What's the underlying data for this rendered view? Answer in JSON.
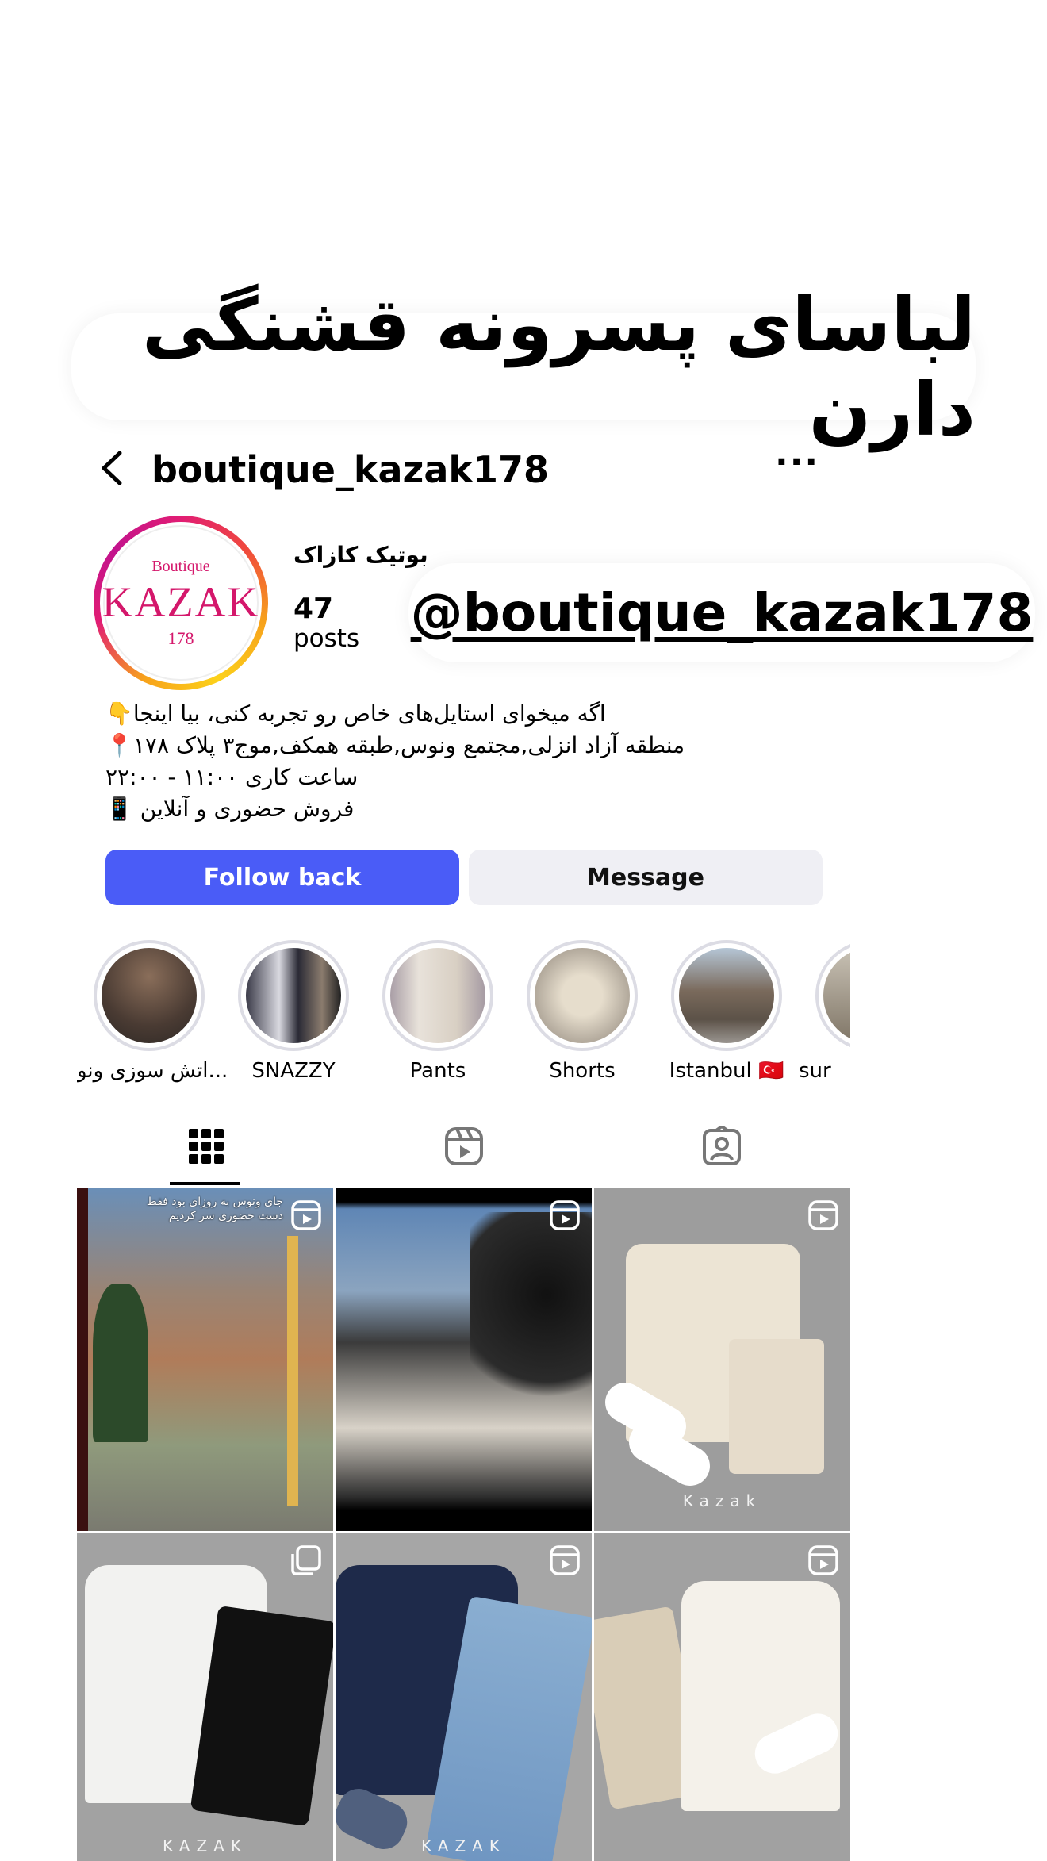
{
  "overlay": {
    "title": "لباسای پسرونه قشنگی دارن",
    "handle": "@boutique_kazak178"
  },
  "header": {
    "username": "boutique_kazak178",
    "back_icon": "chevron-left-icon",
    "more_label": "···"
  },
  "profile": {
    "display_name": "بوتیک کازاک",
    "posts_count": "47",
    "posts_label": "posts",
    "logo": {
      "top": "Boutique",
      "mid": "KAZAK",
      "bottom": "178"
    },
    "bio": [
      "اگه میخوای استایل‌های خاص رو تجربه کنی، بیا اینجا👇",
      "منطقه آزاد انزلی,مجتمع ونوس,طبقه همکف,موج۳ پلاک ۱۷۸📍",
      "ساعت کاری ۱۱:۰۰ - ۲۲:۰۰",
      "فروش حضوری و آنلاین 📱"
    ]
  },
  "buttons": {
    "follow": "Follow back",
    "message": "Message"
  },
  "highlights": [
    {
      "label": "اتش سوزی ونو..."
    },
    {
      "label": "SNAZZY"
    },
    {
      "label": "Pants"
    },
    {
      "label": "Shorts"
    },
    {
      "label": "Istanbul 🇹🇷"
    },
    {
      "label": "sur"
    }
  ],
  "tabs": [
    "grid-icon",
    "reels-icon",
    "tagged-icon"
  ],
  "posts": [
    {
      "type": "reel",
      "caption": "جای ونوس به روزای بود فقط\nدست حضوری سر کردیم"
    },
    {
      "type": "reel",
      "caption": ""
    },
    {
      "type": "reel",
      "brand": "Kazak"
    },
    {
      "type": "carousel",
      "brand": "KAZAK"
    },
    {
      "type": "reel",
      "brand": "KAZAK"
    },
    {
      "type": "reel",
      "brand": ""
    }
  ],
  "colors": {
    "follow_button": "#4a5cf7",
    "message_button": "#efeff4",
    "logo": "#d4176b"
  }
}
